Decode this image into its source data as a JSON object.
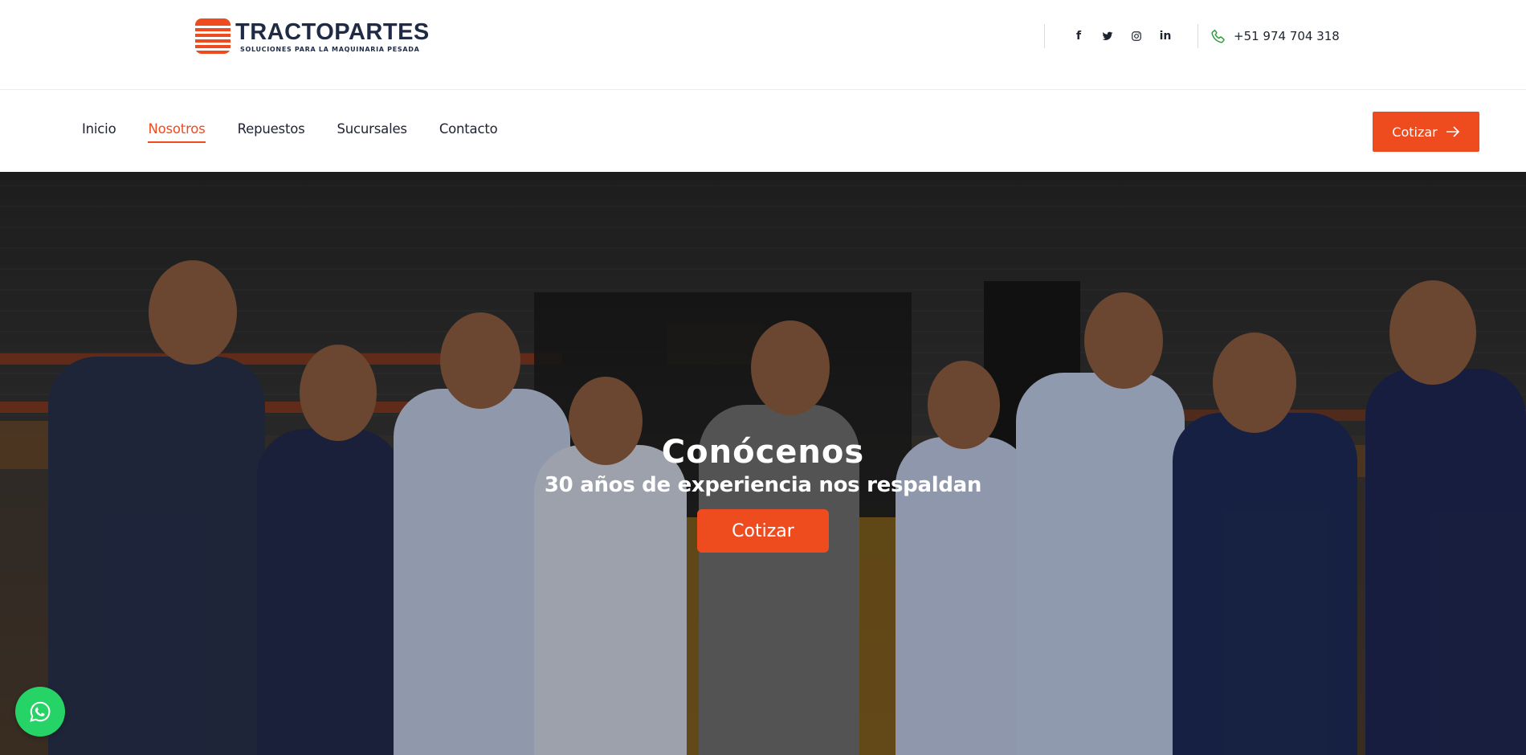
{
  "brand": {
    "name": "TRACTOPARTES",
    "tagline": "SOLUCIONES PARA LA MAQUINARIA PESADA",
    "accent": "#ee4b1f",
    "navy": "#1f2a44"
  },
  "header": {
    "social": [
      {
        "name": "facebook",
        "icon": "facebook-icon",
        "glyph": "f"
      },
      {
        "name": "twitter",
        "icon": "twitter-icon"
      },
      {
        "name": "instagram",
        "icon": "instagram-icon"
      },
      {
        "name": "linkedin",
        "icon": "linkedin-icon",
        "glyph": "in"
      }
    ],
    "phone": "+51 974 704 318"
  },
  "nav": {
    "items": [
      {
        "label": "Inicio",
        "active": false
      },
      {
        "label": "Nosotros",
        "active": true
      },
      {
        "label": "Repuestos",
        "active": false
      },
      {
        "label": "Sucursales",
        "active": false
      },
      {
        "label": "Contacto",
        "active": false
      }
    ],
    "cta_label": "Cotizar"
  },
  "hero": {
    "title": "Conócenos",
    "subtitle": "30 años de experiencia nos respaldan",
    "button_label": "Cotizar"
  },
  "whatsapp": {
    "icon": "whatsapp-icon",
    "color": "#25d366"
  }
}
